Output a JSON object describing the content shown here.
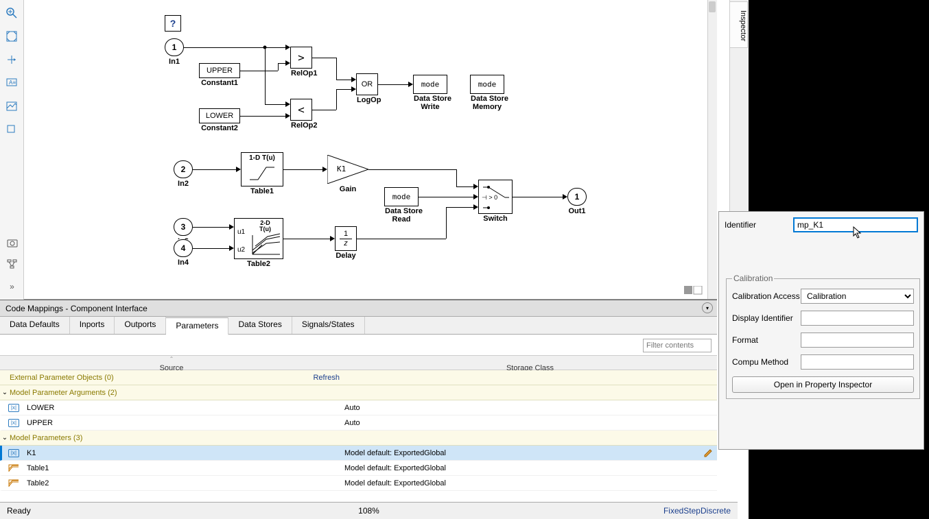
{
  "ports": {
    "in1": {
      "num": "1",
      "label": "In1"
    },
    "in2": {
      "num": "2",
      "label": "In2"
    },
    "in3": {
      "num": "3",
      "label": "In3"
    },
    "in4": {
      "num": "4",
      "label": "In4"
    },
    "out1": {
      "num": "1",
      "label": "Out1"
    }
  },
  "blocks": {
    "help": "?",
    "constant1": {
      "text": "UPPER",
      "label": "Constant1"
    },
    "constant2": {
      "text": "LOWER",
      "label": "Constant2"
    },
    "relop1": {
      "text": ">",
      "label": "RelOp1"
    },
    "relop2": {
      "text": "<",
      "label": "RelOp2"
    },
    "logop": {
      "text": "OR",
      "label": "LogOp"
    },
    "dsw": {
      "text": "mode",
      "label": "Data Store\nWrite"
    },
    "dsm": {
      "text": "mode",
      "label": "Data Store\nMemory"
    },
    "table1": {
      "head": "1-D T(u)",
      "label": "Table1"
    },
    "gain": {
      "text": "K1",
      "label": "Gain"
    },
    "dsr": {
      "text": "mode",
      "label": "Data Store\nRead"
    },
    "switch": {
      "cond": "⊣ > 0",
      "label": "Switch"
    },
    "table2": {
      "head": "2-D\nT(u)",
      "u1": "u1",
      "u2": "u2",
      "label": "Table2"
    },
    "delay": {
      "label": "Delay"
    }
  },
  "inspector_tab": "Inspector",
  "prop": {
    "identifier_label": "Identifier",
    "identifier_value": "mp_K1",
    "calibration_legend": "Calibration",
    "calib_access_label": "Calibration Access",
    "calib_access_value": "Calibration",
    "display_id_label": "Display Identifier",
    "format_label": "Format",
    "compu_label": "Compu Method",
    "open_button": "Open in Property Inspector"
  },
  "bottom": {
    "title": "Code Mappings - Component Interface",
    "tabs": [
      "Data Defaults",
      "Inports",
      "Outports",
      "Parameters",
      "Data Stores",
      "Signals/States"
    ],
    "active_tab": 3,
    "filter_placeholder": "Filter contents",
    "columns": [
      "Source",
      "Storage Class"
    ],
    "groups": [
      {
        "label": "External Parameter Objects (0)",
        "refresh": "Refresh",
        "rows": []
      },
      {
        "label": "Model Parameter Arguments (2)",
        "rows": [
          {
            "icon": "param",
            "name": "LOWER",
            "storage": "Auto"
          },
          {
            "icon": "param",
            "name": "UPPER",
            "storage": "Auto"
          }
        ]
      },
      {
        "label": "Model Parameters (3)",
        "rows": [
          {
            "icon": "param",
            "name": "K1",
            "storage": "Model default: ExportedGlobal",
            "selected": true
          },
          {
            "icon": "table",
            "name": "Table1",
            "storage": "Model default: ExportedGlobal"
          },
          {
            "icon": "table",
            "name": "Table2",
            "storage": "Model default: ExportedGlobal"
          }
        ]
      }
    ]
  },
  "status": {
    "ready": "Ready",
    "zoom": "108%",
    "solver": "FixedStepDiscrete"
  }
}
